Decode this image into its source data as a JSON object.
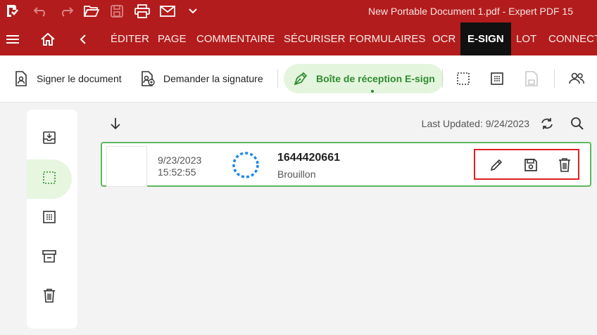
{
  "titlebar": {
    "app_icon": "expert-pdf-logo-icon",
    "quick_access": [
      "undo-icon",
      "redo-icon",
      "open-folder-icon",
      "save-icon",
      "print-icon",
      "email-icon",
      "chevron-down-icon"
    ],
    "document_title": "New Portable Document 1.pdf  -  Expert PDF 15"
  },
  "menubar": {
    "icons": [
      "hamburger-menu-icon",
      "home-icon",
      "back-chevron-icon"
    ],
    "items": [
      "ÉDITER",
      "PAGE",
      "COMMENTAIRE",
      "SÉCURISER",
      "FORMULAIRES",
      "OCR",
      "E-SIGN",
      "LOT",
      "CONNECTI"
    ],
    "active": "E-SIGN"
  },
  "toolbar": {
    "sign_document": "Signer le document",
    "request_signature": "Demander la signature",
    "inbox": "Boîte de réception E-sign",
    "icons": [
      "select-dashed-icon",
      "grid-dots-icon",
      "save-disabled-icon",
      "contacts-icon"
    ]
  },
  "sidebar": {
    "items": [
      "inbox-download-icon",
      "select-dashed-icon",
      "grid-dots-icon",
      "archive-icon",
      "trash-icon"
    ],
    "active_index": 1
  },
  "content": {
    "sort_icon": "arrow-down-icon",
    "last_updated": "Last Updated: 9/24/2023",
    "refresh_icon": "refresh-icon",
    "search_icon": "search-icon"
  },
  "document": {
    "date": "9/23/2023",
    "time": "15:52:55",
    "id": "1644420661",
    "status": "Brouillon",
    "actions": [
      "edit-pencil-icon",
      "save-icon",
      "trash-icon"
    ]
  },
  "colors": {
    "brand_red": "#b31c1c",
    "accent_green": "#2e8b2e",
    "active_bg": "#e4f5de",
    "highlight_red": "#e02020",
    "spinner_blue": "#1e88e5"
  }
}
